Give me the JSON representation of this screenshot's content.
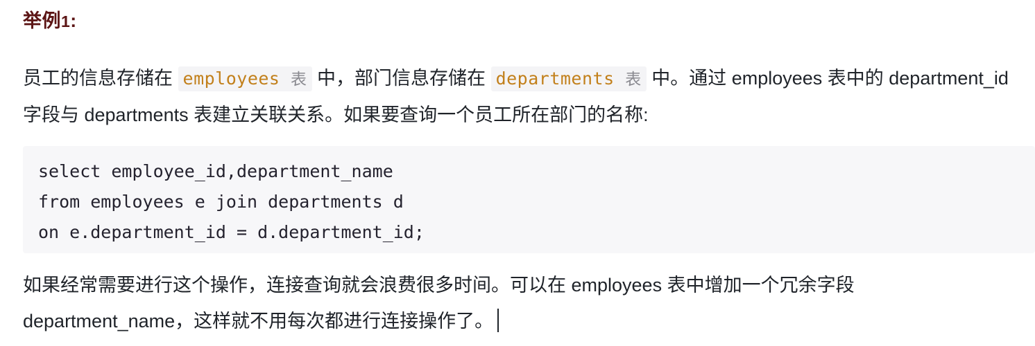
{
  "document": {
    "heading": {
      "text": "举例",
      "number": "1",
      "colon": ":",
      "color": "#5c1515"
    },
    "paragraph_1": {
      "seg_1": "员工的信息存储在 ",
      "code_1": "employees",
      "code_1_cn": "表",
      "seg_2": " 中，部门信息存储在 ",
      "code_2": "departments",
      "code_2_cn": "表",
      "seg_3": " 中。通过 employees 表中的 department_id字段与 departments 表建立关联关系。如果要查询一个员工所在部门的名称:"
    },
    "code_block": {
      "language": "sql",
      "background": "#f7f7f9",
      "lines": [
        "select employee_id,department_name",
        "from employees e join departments d",
        "on e.department_id = d.department_id;"
      ]
    },
    "paragraph_2": {
      "text": "如果经常需要进行这个操作，连接查询就会浪费很多时间。可以在 employees 表中增加一个冗余字段 department_name，这样就不用每次都进行连接操作了。"
    },
    "caret": {
      "visible": true,
      "color": "#1f2329"
    },
    "colors": {
      "text": "#1f2329",
      "heading": "#5c1515",
      "inline_code_text": "#c2801b",
      "inline_code_bg": "#f4f4f6",
      "code_block_bg": "#f7f7f9",
      "code_block_text": "#24222e",
      "page_bg": "#ffffff"
    }
  }
}
